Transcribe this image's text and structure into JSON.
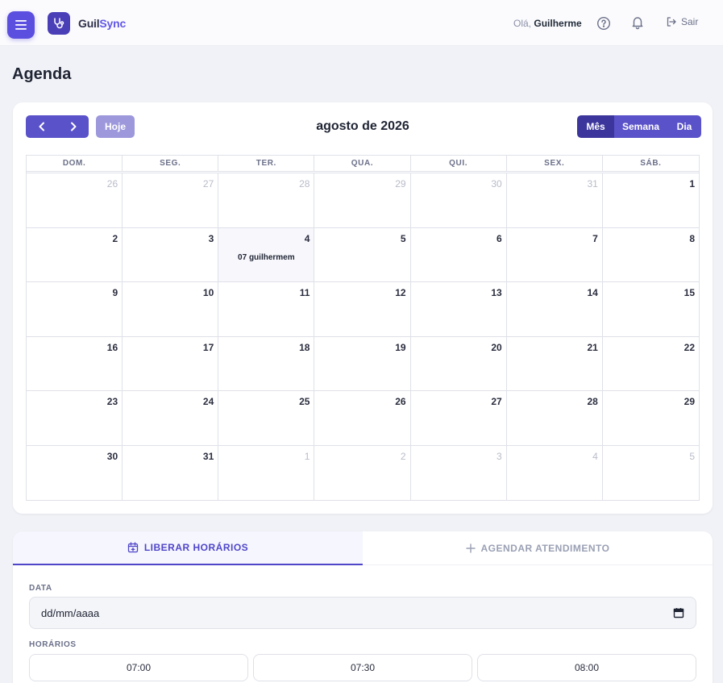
{
  "header": {
    "brand_part1": "Guil",
    "brand_part2": "Sync",
    "greeting": "Olá,",
    "user_name": "Guilherme",
    "logout_label": "Sair"
  },
  "page": {
    "title": "Agenda"
  },
  "calendar": {
    "today_label": "Hoje",
    "title": "agosto de 2026",
    "views": {
      "month": "Mês",
      "week": "Semana",
      "day": "Dia"
    },
    "active_view": "month",
    "weekdays": [
      "DOM.",
      "SEG.",
      "TER.",
      "QUA.",
      "QUI.",
      "SEX.",
      "SÁB."
    ],
    "weeks": [
      [
        {
          "n": "26",
          "o": true
        },
        {
          "n": "27",
          "o": true
        },
        {
          "n": "28",
          "o": true
        },
        {
          "n": "29",
          "o": true
        },
        {
          "n": "30",
          "o": true
        },
        {
          "n": "31",
          "o": true
        },
        {
          "n": "1",
          "o": false
        }
      ],
      [
        {
          "n": "2",
          "o": false
        },
        {
          "n": "3",
          "o": false
        },
        {
          "n": "4",
          "o": false,
          "today": true,
          "event": "07 guilhermem"
        },
        {
          "n": "5",
          "o": false
        },
        {
          "n": "6",
          "o": false
        },
        {
          "n": "7",
          "o": false
        },
        {
          "n": "8",
          "o": false
        }
      ],
      [
        {
          "n": "9",
          "o": false
        },
        {
          "n": "10",
          "o": false
        },
        {
          "n": "11",
          "o": false
        },
        {
          "n": "12",
          "o": false
        },
        {
          "n": "13",
          "o": false
        },
        {
          "n": "14",
          "o": false
        },
        {
          "n": "15",
          "o": false
        }
      ],
      [
        {
          "n": "16",
          "o": false
        },
        {
          "n": "17",
          "o": false
        },
        {
          "n": "18",
          "o": false
        },
        {
          "n": "19",
          "o": false
        },
        {
          "n": "20",
          "o": false
        },
        {
          "n": "21",
          "o": false
        },
        {
          "n": "22",
          "o": false
        }
      ],
      [
        {
          "n": "23",
          "o": false
        },
        {
          "n": "24",
          "o": false
        },
        {
          "n": "25",
          "o": false
        },
        {
          "n": "26",
          "o": false
        },
        {
          "n": "27",
          "o": false
        },
        {
          "n": "28",
          "o": false
        },
        {
          "n": "29",
          "o": false
        }
      ],
      [
        {
          "n": "30",
          "o": false
        },
        {
          "n": "31",
          "o": false
        },
        {
          "n": "1",
          "o": true
        },
        {
          "n": "2",
          "o": true
        },
        {
          "n": "3",
          "o": true
        },
        {
          "n": "4",
          "o": true
        },
        {
          "n": "5",
          "o": true
        }
      ]
    ]
  },
  "form": {
    "tabs": {
      "release": "LIBERAR HORÁRIOS",
      "schedule": "AGENDAR ATENDIMENTO"
    },
    "date_label": "DATA",
    "date_value": "dd/mm/aaaa",
    "times_label": "HORÁRIOS",
    "slots": [
      "07:00",
      "07:30",
      "08:00"
    ]
  },
  "colors": {
    "accent": "#5b4fe0",
    "button": "#5a52c9",
    "button_active": "#3c359c",
    "today_btn": "#9d98dc",
    "background": "#f1f2f7"
  },
  "icons": [
    "menu-icon",
    "stethoscope-icon",
    "help-icon",
    "bell-icon",
    "logout-icon",
    "chevron-left-icon",
    "chevron-right-icon",
    "calendar-plus-icon",
    "plus-icon",
    "calendar-icon"
  ]
}
